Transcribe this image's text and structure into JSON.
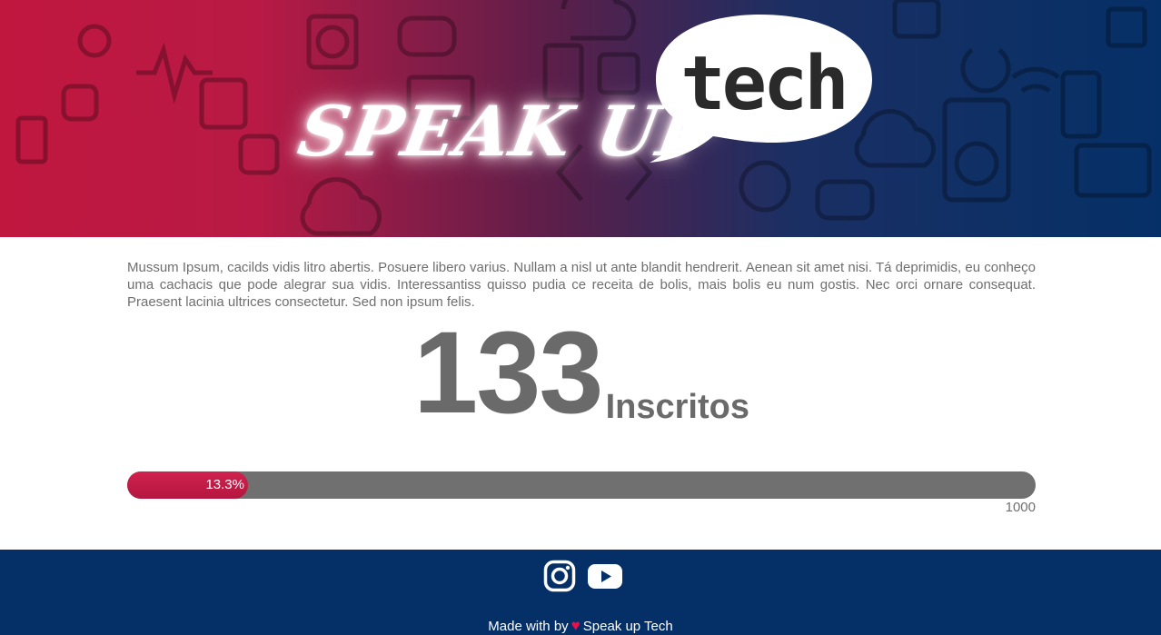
{
  "header": {
    "title": "SPEAK UP",
    "bubble_text": "tech",
    "colors": {
      "left": "#c0173f",
      "middle": "#5a1f4a",
      "right": "#053067"
    }
  },
  "intro": {
    "text": "Mussum Ipsum, cacilds vidis litro abertis. Posuere libero varius. Nullam a nisl ut ante blandit hendrerit. Aenean sit amet nisi. Tá deprimidis, eu conheço uma cachacis que pode alegrar sua vidis. Interessantiss quisso pudia ce receita de bolis, mais bolis eu num gostis. Nec orci ornare consequat. Praesent lacinia ultrices consectetur. Sed non ipsum felis."
  },
  "counter": {
    "value": "133",
    "label": "Inscritos"
  },
  "progress": {
    "fraction": 0.133,
    "percent_label": "13.3%",
    "max_label": "1000",
    "fill_color": "#c0173f",
    "track_color": "#707070"
  },
  "footer": {
    "icons": [
      "instagram-icon",
      "youtube-icon"
    ],
    "made_with": "Made with by",
    "brand": "Speak up Tech",
    "heart_glyph": "♥",
    "background": "#053067"
  }
}
